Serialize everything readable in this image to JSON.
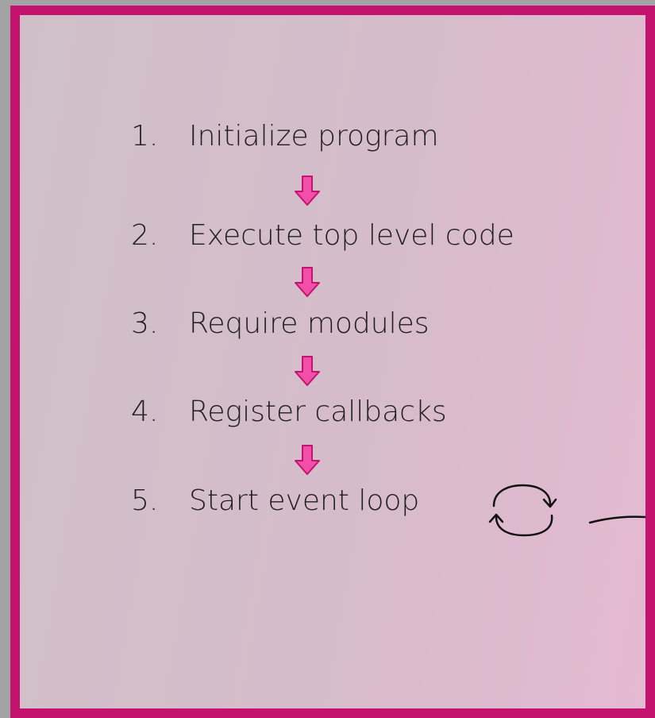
{
  "steps": [
    {
      "number": "1.",
      "label": "Initialize program"
    },
    {
      "number": "2.",
      "label": "Execute top level code"
    },
    {
      "number": "3.",
      "label": "Require modules"
    },
    {
      "number": "4.",
      "label": "Register callbacks"
    },
    {
      "number": "5.",
      "label": "Start event loop"
    }
  ],
  "icons": {
    "step_arrow": "arrow-down-icon",
    "loop_sketch": "loop-cycle-icon"
  },
  "colors": {
    "frame_border": "#c4136f",
    "arrow_fill": "#f24fa8",
    "arrow_stroke": "#c4136f"
  }
}
